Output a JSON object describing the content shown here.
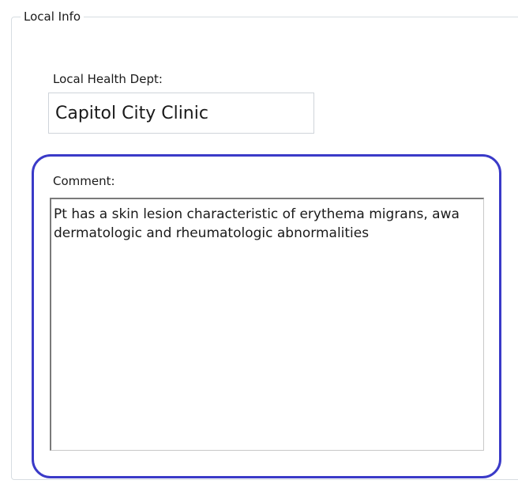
{
  "group": {
    "title": "Local Info"
  },
  "local_health_dept": {
    "label": "Local Health Dept:",
    "value": "Capitol City Clinic"
  },
  "comment": {
    "label": "Comment:",
    "value": "Pt has a skin lesion characteristic of erythema migrans, awa dermatologic and rheumatologic abnormalities"
  },
  "colors": {
    "highlight_border": "#3a3ac8",
    "groupbox_border": "#d7dde2"
  }
}
